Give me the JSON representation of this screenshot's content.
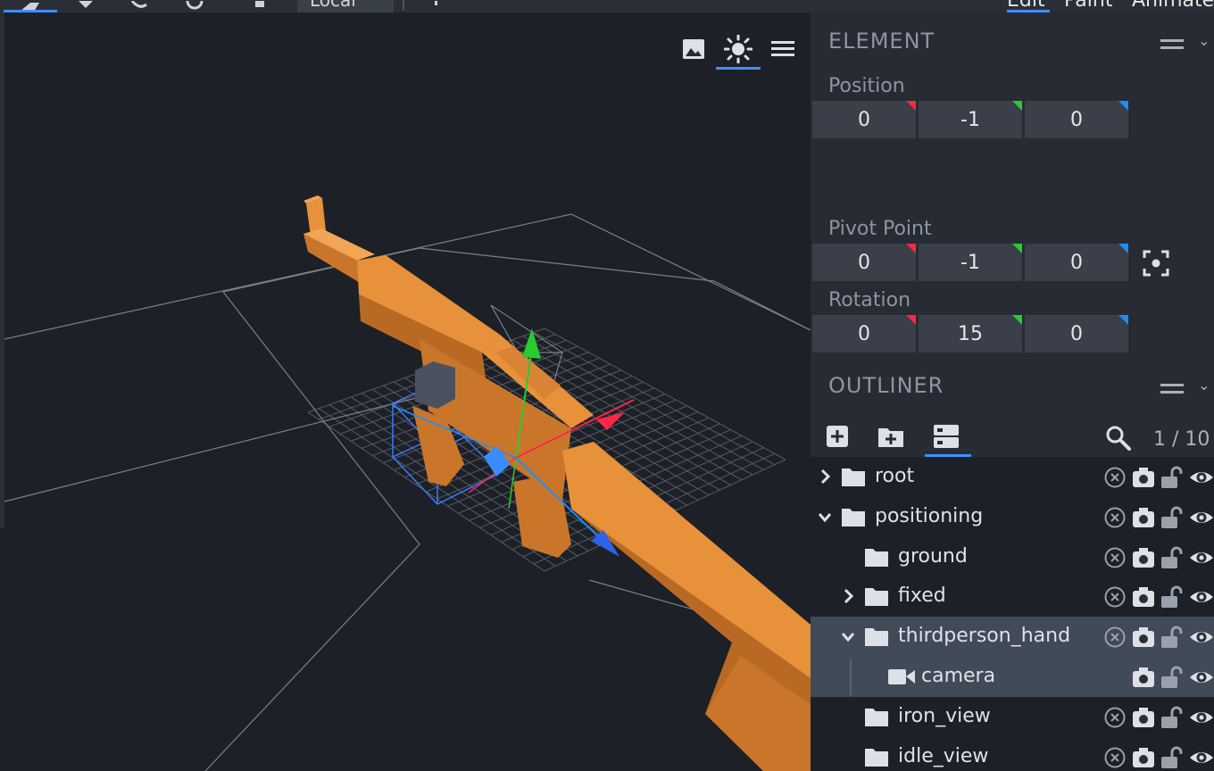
{
  "toolbar": {
    "local_label": "Local",
    "mode_tabs": [
      "Edit",
      "Paint",
      "Animate"
    ]
  },
  "viewport": {
    "tools": [
      {
        "name": "background-image",
        "icon": "image-icon",
        "active": false
      },
      {
        "name": "lighting",
        "icon": "sun-icon",
        "active": true
      },
      {
        "name": "menu",
        "icon": "hamburger-menu-icon",
        "active": false
      }
    ],
    "model_color": "#e8913b",
    "gizmo_colors": {
      "x": "#ff2646",
      "y": "#28cc2e",
      "z": "#1e8cff"
    }
  },
  "element_panel": {
    "title": "ELEMENT",
    "position": {
      "label": "Position",
      "x": "0",
      "y": "-1",
      "z": "0"
    },
    "pivot": {
      "label": "Pivot Point",
      "x": "0",
      "y": "-1",
      "z": "0"
    },
    "rotation": {
      "label": "Rotation",
      "x": "0",
      "y": "15",
      "z": "0"
    }
  },
  "outliner": {
    "title": "OUTLINER",
    "count": "1 / 10",
    "tools": [
      "add-cube-icon",
      "add-group-icon",
      "toggle-options-icon"
    ],
    "rows": [
      {
        "name": "root",
        "icon": "folder-icon",
        "expanded": false,
        "has_children": true,
        "depth": 0
      },
      {
        "name": "positioning",
        "icon": "folder-icon",
        "expanded": true,
        "has_children": true,
        "depth": 0
      },
      {
        "name": "ground",
        "icon": "folder-icon",
        "has_children": false,
        "depth": 1
      },
      {
        "name": "fixed",
        "icon": "folder-icon",
        "expanded": false,
        "has_children": true,
        "depth": 1
      },
      {
        "name": "thirdperson_hand",
        "icon": "folder-icon",
        "expanded": true,
        "has_children": true,
        "depth": 1,
        "selected": true
      },
      {
        "name": "camera",
        "icon": "camera-icon",
        "has_children": false,
        "depth": 2,
        "selected": true
      },
      {
        "name": "iron_view",
        "icon": "folder-icon",
        "has_children": false,
        "depth": 1
      },
      {
        "name": "idle_view",
        "icon": "folder-icon",
        "has_children": false,
        "depth": 1
      }
    ]
  },
  "colors": {
    "accent": "#3e90ff",
    "panel": "#272b33",
    "viewport": "#1d2027"
  }
}
